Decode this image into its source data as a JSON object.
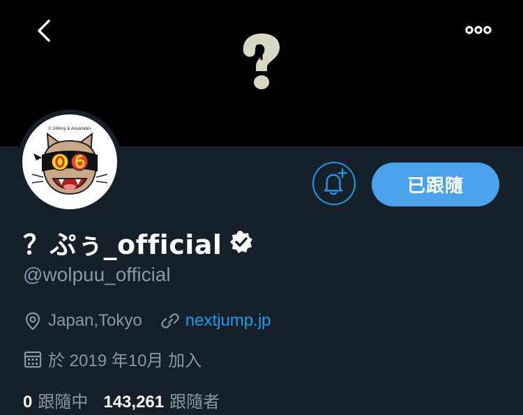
{
  "header": {
    "back_icon": "chevron-left-icon",
    "more_icon": "more-dots-icon",
    "banner_logo": "question-mark-logo"
  },
  "profile": {
    "avatar_caption": "© Johnny & Associates",
    "display_name": "？ぷぅ_official",
    "verified_icon": "verified-badge-icon",
    "handle": "@wolpuu_official"
  },
  "actions": {
    "notify_icon": "bell-plus-icon",
    "follow_label": "已跟隨"
  },
  "meta": {
    "location": "Japan,Tokyo",
    "location_icon": "location-pin-icon",
    "website": "nextjump.jp",
    "website_icon": "link-icon",
    "joined": "於 2019 年10月 加入",
    "joined_icon": "calendar-icon"
  },
  "stats": {
    "following_count": "0",
    "following_label": "跟隨中",
    "followers_count": "143,261",
    "followers_label": "跟隨者"
  },
  "colors": {
    "background": "#15202b",
    "banner": "#000000",
    "accent": "#1d9bf0",
    "button": "#4aa3ea",
    "secondary_text": "#8899a6"
  }
}
